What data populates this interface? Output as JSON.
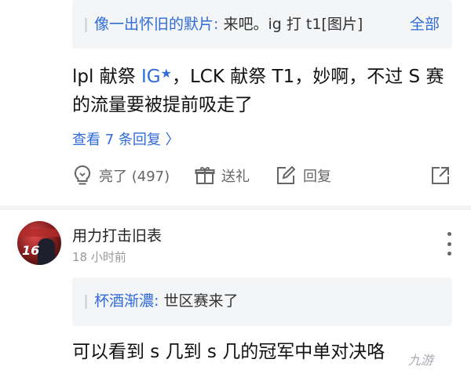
{
  "reply_quote": {
    "author": "像一出怀旧的默片",
    "colon": ":",
    "text": " 来吧。ig 打 t1[图片]",
    "all_label": "全部"
  },
  "comment": {
    "text_before": "lpl 献祭 ",
    "highlight": "IG",
    "text_after": "，LCK 献祭 T1，妙啊，不过 S 赛的流量要被提前吸走了"
  },
  "view_replies": {
    "label": "查看 7 条回复 〉"
  },
  "actions": {
    "like_label": "亮了 (497)",
    "gift_label": "送礼",
    "reply_label": "回复"
  },
  "comment2": {
    "user_name": "用力打击旧表",
    "time": "18 小时前",
    "avatar_number": "16",
    "quote": {
      "author": "杯酒渐濃",
      "colon": ":",
      "text": " 世区赛来了"
    },
    "text": "可以看到 s 几到 s 几的冠军中单对决咯"
  },
  "watermark": {
    "text": "九游"
  },
  "colors": {
    "link_blue": "#2f6bd9",
    "quote_bg": "#f4f5f7",
    "divider": "#f2f3f5",
    "muted_gray": "#999999"
  },
  "icons": [
    "lightbulb-icon",
    "gift-icon",
    "edit-icon",
    "share-icon",
    "more-vertical-icon",
    "chevron-right-icon"
  ]
}
